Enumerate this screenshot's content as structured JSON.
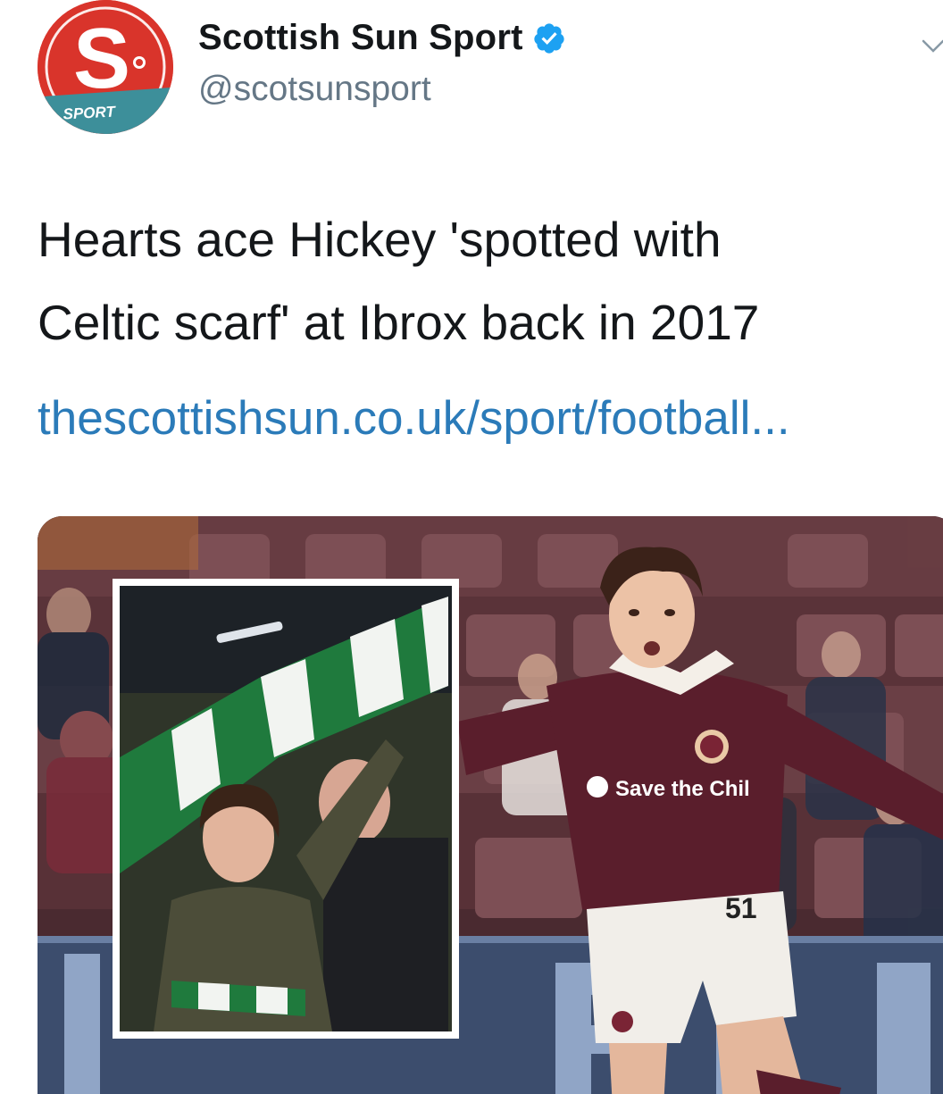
{
  "account": {
    "display_name": "Scottish Sun Sport",
    "handle": "@scotsunsport",
    "verified": true,
    "avatar_letter": "S",
    "avatar_label": "SPORT"
  },
  "tweet": {
    "text_line_1": "Hearts ace Hickey 'spotted with",
    "text_line_2": "Celtic scarf' at Ibrox back in 2017",
    "link_text": "thescottishsun.co.uk/sport/football..."
  },
  "media": {
    "shirt_sponsor": "Save the Chil",
    "shirt_number": "51"
  },
  "colors": {
    "brand_red": "#d9342b",
    "link_blue": "#2b7bb9",
    "verified_blue": "#1da1f2",
    "hearts_maroon": "#5a1e2c"
  },
  "icons": [
    "verified-badge-icon",
    "chevron-down-icon"
  ]
}
